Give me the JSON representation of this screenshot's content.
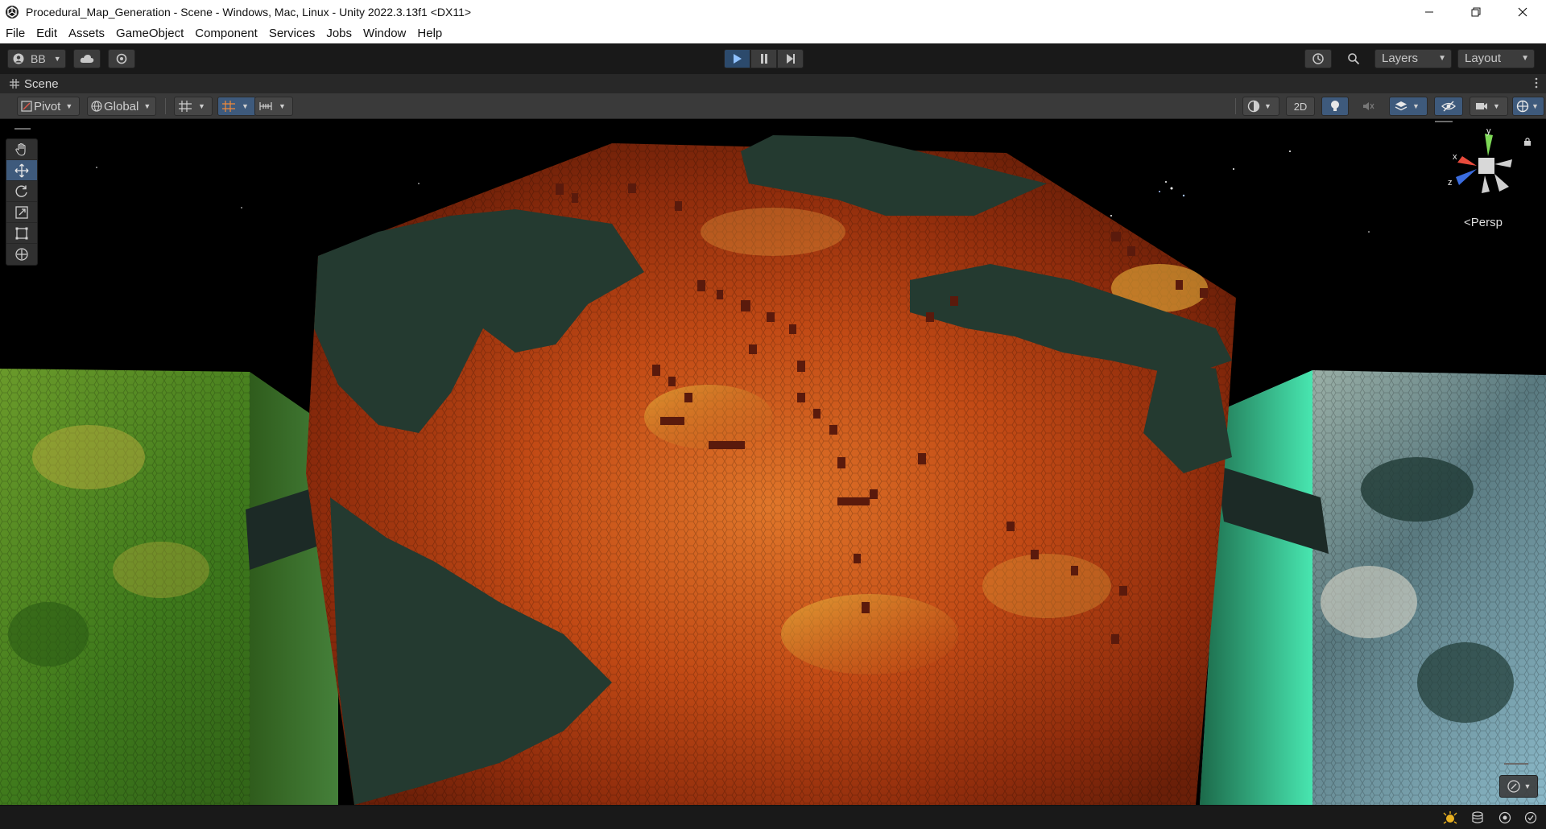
{
  "window": {
    "title": "Procedural_Map_Generation - Scene - Windows, Mac, Linux - Unity 2022.3.13f1 <DX11>",
    "controls": [
      "minimize",
      "restore",
      "close"
    ]
  },
  "menu": {
    "items": [
      "File",
      "Edit",
      "Assets",
      "GameObject",
      "Component",
      "Services",
      "Jobs",
      "Window",
      "Help"
    ]
  },
  "toolbar": {
    "account_label": "BB",
    "layers_label": "Layers",
    "layout_label": "Layout",
    "play_state": "playing"
  },
  "scene_tab": {
    "label": "Scene"
  },
  "scene_toolbar": {
    "pivot_label": "Pivot",
    "space_label": "Global",
    "mode_2d_label": "2D"
  },
  "tools": [
    "hand-tool",
    "move-tool",
    "rotate-tool",
    "scale-tool",
    "rect-tool",
    "transform-tool"
  ],
  "active_tool": "move-tool",
  "gizmo": {
    "x_label": "x",
    "y_label": "y",
    "z_label": "z",
    "projection_label": "Persp"
  },
  "colors": {
    "accent_blue": "#3e5a7c",
    "terrain_orange": "#c8501a",
    "terrain_dark": "#243a30",
    "terrain_green": "#4a8a1e",
    "terrain_teal": "#3ed6a0"
  }
}
